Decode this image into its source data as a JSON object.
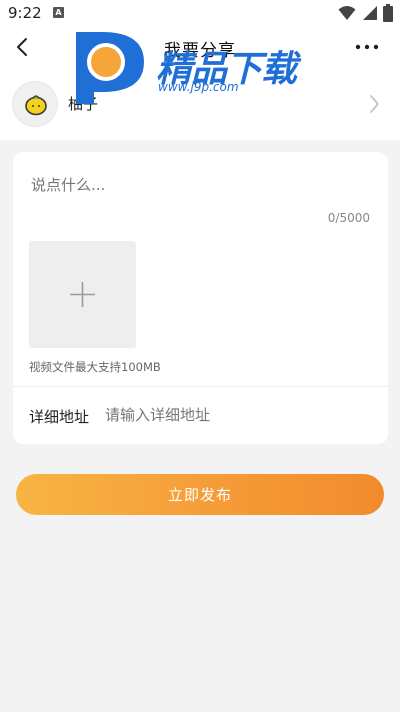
{
  "status_bar": {
    "time": "9:22",
    "app_icon_letter": "A",
    "icons": [
      "wifi-icon",
      "signal-icon",
      "battery-icon"
    ]
  },
  "header": {
    "title": "我要分享",
    "back_icon": "chevron-left-icon",
    "more_icon": "more-horizontal-icon"
  },
  "watermark": {
    "brand": "精品下载",
    "url": "www.j9p.com",
    "colors": {
      "blue": "#1f6fd6",
      "orange": "#f5a53a"
    }
  },
  "user": {
    "name": "柚子",
    "avatar_icon": "lemon-icon"
  },
  "composer": {
    "placeholder": "说点什么...",
    "value": "",
    "counter": "0/5000",
    "upload_icon": "plus-icon",
    "upload_hint": "视频文件最大支持100MB"
  },
  "address": {
    "label": "详细地址",
    "placeholder": "请输入详细地址",
    "value": ""
  },
  "publish": {
    "label": "立即发布",
    "color_start": "#f8b543",
    "color_end": "#f28a2c"
  }
}
